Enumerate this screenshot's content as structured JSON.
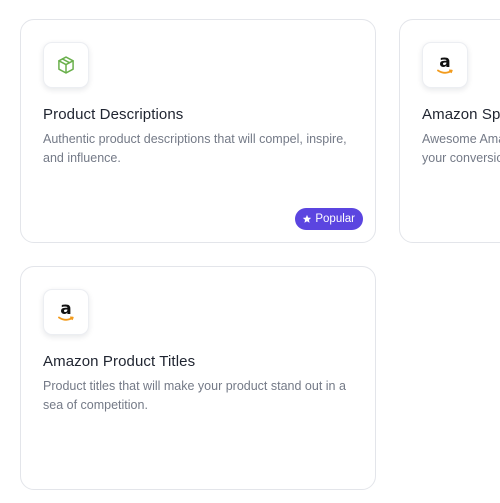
{
  "cards": [
    {
      "icon": "box-icon",
      "title": "Product Descriptions",
      "description": "Authentic product descriptions that will compel, inspire, and influence.",
      "badge": "Popular"
    },
    {
      "icon": "amazon-logo-icon",
      "logo_letter": "a",
      "title": "Amazon Sponsored Brand Ads",
      "description": "Awesome Amazon sponsored brand ads that will boost your conversion rates."
    },
    {
      "icon": "amazon-logo-icon",
      "logo_letter": "a",
      "title": "Amazon Product Titles",
      "description": "Product titles that will make your product stand out in a sea of competition."
    }
  ],
  "colors": {
    "badge_background": "#5b45e0",
    "box_icon": "#6ab04c",
    "amazon_smile": "#f29b1d"
  }
}
